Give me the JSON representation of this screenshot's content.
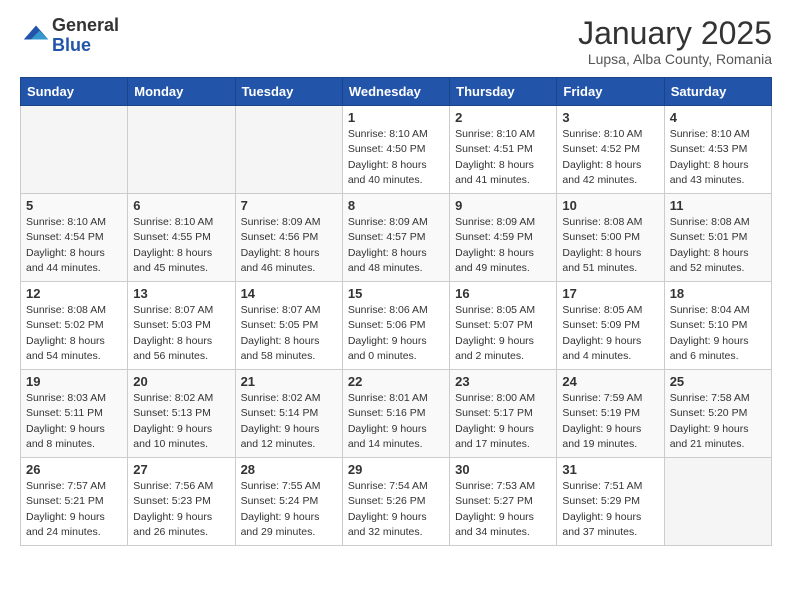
{
  "logo": {
    "general": "General",
    "blue": "Blue"
  },
  "title": "January 2025",
  "subtitle": "Lupsa, Alba County, Romania",
  "days_of_week": [
    "Sunday",
    "Monday",
    "Tuesday",
    "Wednesday",
    "Thursday",
    "Friday",
    "Saturday"
  ],
  "weeks": [
    [
      {
        "day": "",
        "info": ""
      },
      {
        "day": "",
        "info": ""
      },
      {
        "day": "",
        "info": ""
      },
      {
        "day": "1",
        "info": "Sunrise: 8:10 AM\nSunset: 4:50 PM\nDaylight: 8 hours\nand 40 minutes."
      },
      {
        "day": "2",
        "info": "Sunrise: 8:10 AM\nSunset: 4:51 PM\nDaylight: 8 hours\nand 41 minutes."
      },
      {
        "day": "3",
        "info": "Sunrise: 8:10 AM\nSunset: 4:52 PM\nDaylight: 8 hours\nand 42 minutes."
      },
      {
        "day": "4",
        "info": "Sunrise: 8:10 AM\nSunset: 4:53 PM\nDaylight: 8 hours\nand 43 minutes."
      }
    ],
    [
      {
        "day": "5",
        "info": "Sunrise: 8:10 AM\nSunset: 4:54 PM\nDaylight: 8 hours\nand 44 minutes."
      },
      {
        "day": "6",
        "info": "Sunrise: 8:10 AM\nSunset: 4:55 PM\nDaylight: 8 hours\nand 45 minutes."
      },
      {
        "day": "7",
        "info": "Sunrise: 8:09 AM\nSunset: 4:56 PM\nDaylight: 8 hours\nand 46 minutes."
      },
      {
        "day": "8",
        "info": "Sunrise: 8:09 AM\nSunset: 4:57 PM\nDaylight: 8 hours\nand 48 minutes."
      },
      {
        "day": "9",
        "info": "Sunrise: 8:09 AM\nSunset: 4:59 PM\nDaylight: 8 hours\nand 49 minutes."
      },
      {
        "day": "10",
        "info": "Sunrise: 8:08 AM\nSunset: 5:00 PM\nDaylight: 8 hours\nand 51 minutes."
      },
      {
        "day": "11",
        "info": "Sunrise: 8:08 AM\nSunset: 5:01 PM\nDaylight: 8 hours\nand 52 minutes."
      }
    ],
    [
      {
        "day": "12",
        "info": "Sunrise: 8:08 AM\nSunset: 5:02 PM\nDaylight: 8 hours\nand 54 minutes."
      },
      {
        "day": "13",
        "info": "Sunrise: 8:07 AM\nSunset: 5:03 PM\nDaylight: 8 hours\nand 56 minutes."
      },
      {
        "day": "14",
        "info": "Sunrise: 8:07 AM\nSunset: 5:05 PM\nDaylight: 8 hours\nand 58 minutes."
      },
      {
        "day": "15",
        "info": "Sunrise: 8:06 AM\nSunset: 5:06 PM\nDaylight: 9 hours\nand 0 minutes."
      },
      {
        "day": "16",
        "info": "Sunrise: 8:05 AM\nSunset: 5:07 PM\nDaylight: 9 hours\nand 2 minutes."
      },
      {
        "day": "17",
        "info": "Sunrise: 8:05 AM\nSunset: 5:09 PM\nDaylight: 9 hours\nand 4 minutes."
      },
      {
        "day": "18",
        "info": "Sunrise: 8:04 AM\nSunset: 5:10 PM\nDaylight: 9 hours\nand 6 minutes."
      }
    ],
    [
      {
        "day": "19",
        "info": "Sunrise: 8:03 AM\nSunset: 5:11 PM\nDaylight: 9 hours\nand 8 minutes."
      },
      {
        "day": "20",
        "info": "Sunrise: 8:02 AM\nSunset: 5:13 PM\nDaylight: 9 hours\nand 10 minutes."
      },
      {
        "day": "21",
        "info": "Sunrise: 8:02 AM\nSunset: 5:14 PM\nDaylight: 9 hours\nand 12 minutes."
      },
      {
        "day": "22",
        "info": "Sunrise: 8:01 AM\nSunset: 5:16 PM\nDaylight: 9 hours\nand 14 minutes."
      },
      {
        "day": "23",
        "info": "Sunrise: 8:00 AM\nSunset: 5:17 PM\nDaylight: 9 hours\nand 17 minutes."
      },
      {
        "day": "24",
        "info": "Sunrise: 7:59 AM\nSunset: 5:19 PM\nDaylight: 9 hours\nand 19 minutes."
      },
      {
        "day": "25",
        "info": "Sunrise: 7:58 AM\nSunset: 5:20 PM\nDaylight: 9 hours\nand 21 minutes."
      }
    ],
    [
      {
        "day": "26",
        "info": "Sunrise: 7:57 AM\nSunset: 5:21 PM\nDaylight: 9 hours\nand 24 minutes."
      },
      {
        "day": "27",
        "info": "Sunrise: 7:56 AM\nSunset: 5:23 PM\nDaylight: 9 hours\nand 26 minutes."
      },
      {
        "day": "28",
        "info": "Sunrise: 7:55 AM\nSunset: 5:24 PM\nDaylight: 9 hours\nand 29 minutes."
      },
      {
        "day": "29",
        "info": "Sunrise: 7:54 AM\nSunset: 5:26 PM\nDaylight: 9 hours\nand 32 minutes."
      },
      {
        "day": "30",
        "info": "Sunrise: 7:53 AM\nSunset: 5:27 PM\nDaylight: 9 hours\nand 34 minutes."
      },
      {
        "day": "31",
        "info": "Sunrise: 7:51 AM\nSunset: 5:29 PM\nDaylight: 9 hours\nand 37 minutes."
      },
      {
        "day": "",
        "info": ""
      }
    ]
  ]
}
